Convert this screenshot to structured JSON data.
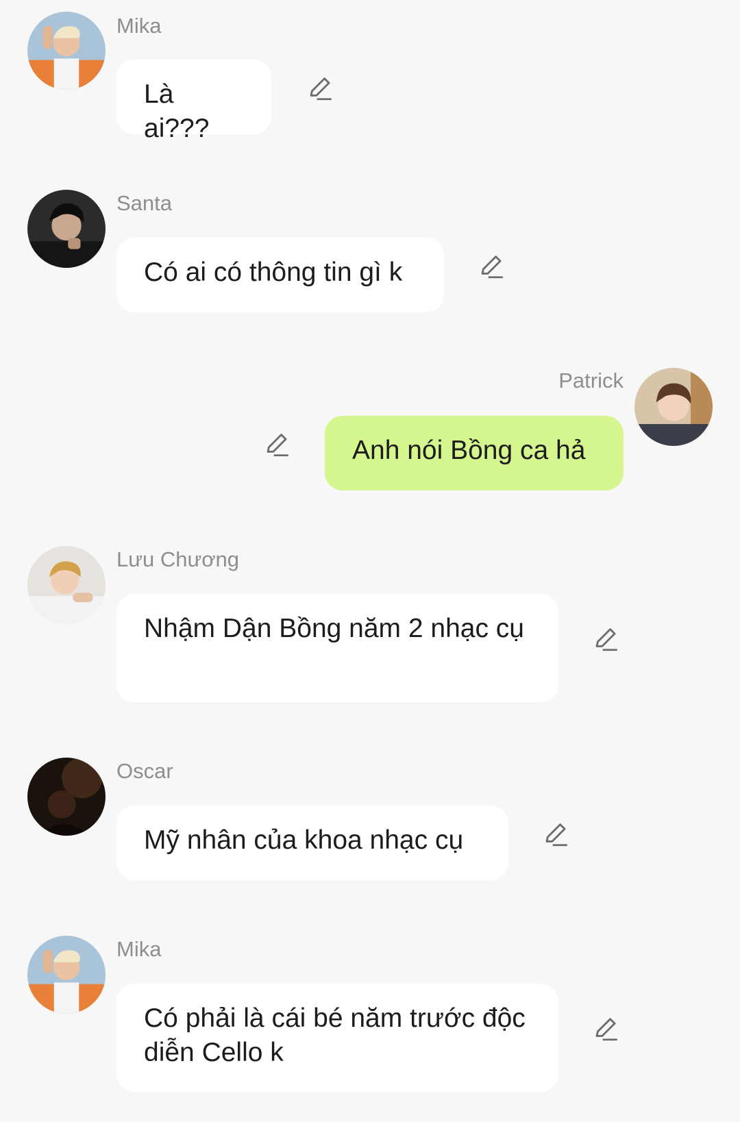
{
  "colors": {
    "background": "#f7f7f7",
    "bubble_incoming": "#ffffff",
    "bubble_outgoing": "#d5f68f",
    "name_text": "#8e8e8e",
    "message_text": "#1c1c1c"
  },
  "messages": [
    {
      "sender": "Mika",
      "text": "Là ai???",
      "outgoing": false,
      "action_icon": "edit-pencil-icon"
    },
    {
      "sender": "Santa",
      "text": "Có ai có thông tin gì k",
      "outgoing": false,
      "action_icon": "edit-pencil-icon"
    },
    {
      "sender": "Patrick",
      "text": "Anh nói Bồng ca hả",
      "outgoing": true,
      "action_icon": "edit-pencil-icon"
    },
    {
      "sender": "Lưu Chương",
      "text": "Nhậm Dận Bồng năm 2 nhạc cụ",
      "outgoing": false,
      "action_icon": "edit-pencil-icon"
    },
    {
      "sender": "Oscar",
      "text": "Mỹ nhân của khoa nhạc cụ",
      "outgoing": false,
      "action_icon": "edit-pencil-icon"
    },
    {
      "sender": "Mika",
      "text": "Có phải là cái bé năm trước độc diễn Cello k",
      "outgoing": false,
      "action_icon": "edit-pencil-icon"
    }
  ]
}
